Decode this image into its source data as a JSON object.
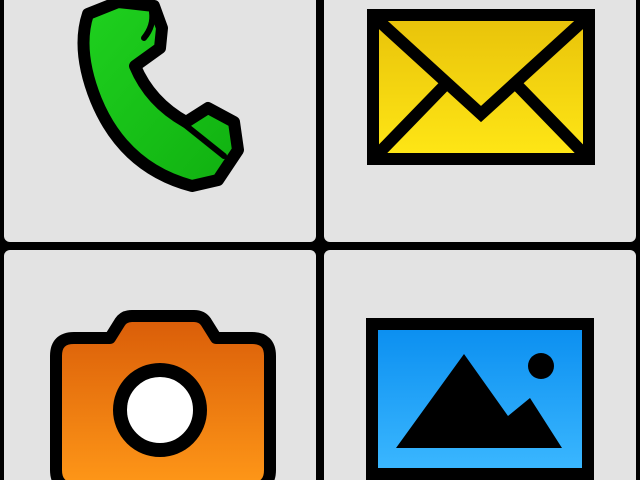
{
  "launcher": {
    "tiles": [
      {
        "id": "phone",
        "icon": "phone-handset-icon",
        "color": "#22cc22"
      },
      {
        "id": "email",
        "icon": "envelope-icon",
        "color": "#f7d516"
      },
      {
        "id": "camera",
        "icon": "camera-icon",
        "color": "#f07d12"
      },
      {
        "id": "gallery",
        "icon": "landscape-picture-icon",
        "color": "#1aa8f5"
      }
    ]
  }
}
